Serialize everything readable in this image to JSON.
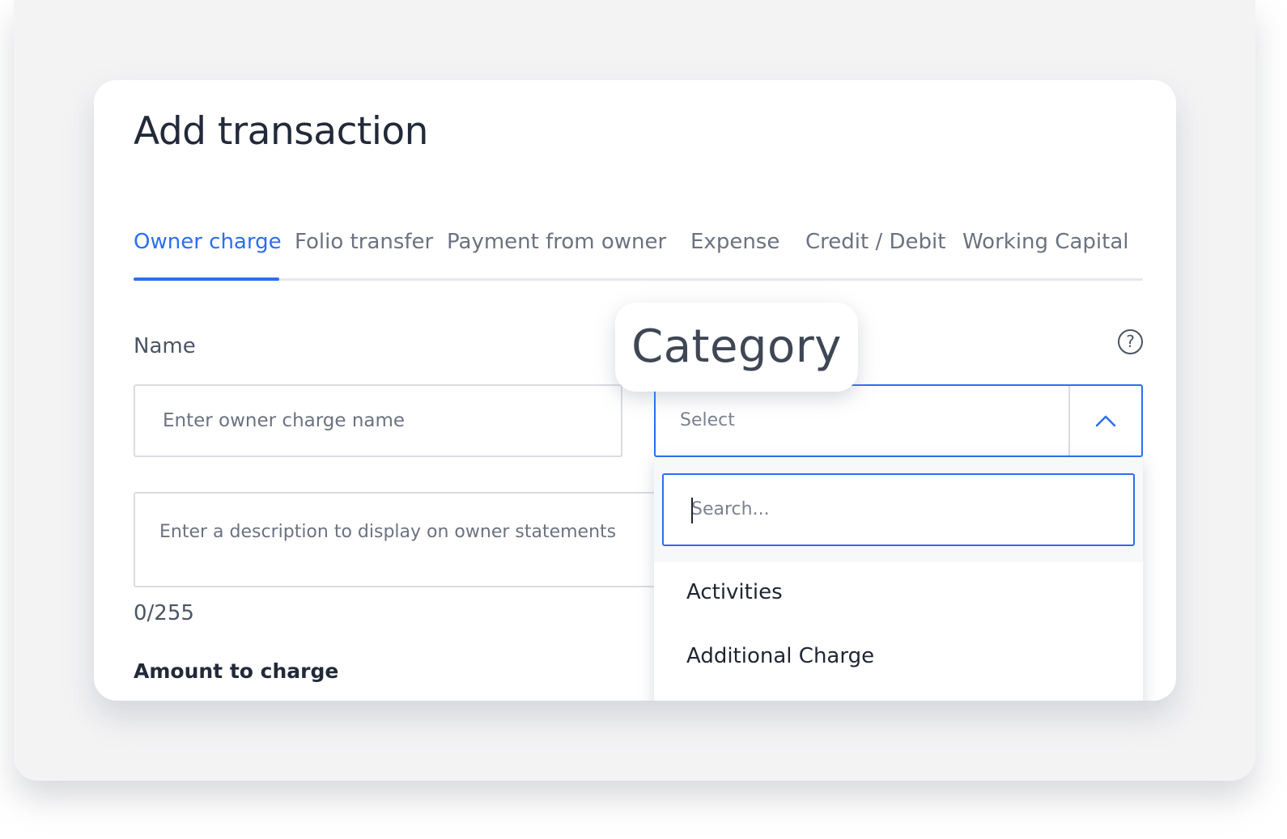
{
  "dialog": {
    "title": "Add transaction"
  },
  "tabs": [
    {
      "label": "Owner charge",
      "active": true
    },
    {
      "label": "Folio transfer",
      "active": false
    },
    {
      "label": "Payment from owner",
      "active": false
    },
    {
      "label": "Expense",
      "active": false
    },
    {
      "label": "Credit / Debit",
      "active": false
    },
    {
      "label": "Working Capital",
      "active": false
    }
  ],
  "form": {
    "name_label": "Name",
    "name_placeholder": "Enter owner charge name",
    "description_placeholder": "Enter a description to display on owner statements",
    "description_counter": "0/255",
    "amount_label": "Amount to charge",
    "help_icon": "?"
  },
  "category": {
    "label": "Category",
    "select_placeholder": "Select",
    "search_placeholder": "Search...",
    "options": [
      "Activities",
      "Additional Charge"
    ]
  },
  "colors": {
    "accent": "#2b6ef2",
    "text_dark": "#222a39",
    "text_muted": "#6b7280",
    "border": "#d9dce1"
  },
  "icons": {
    "select_toggle": "chevron-up-icon",
    "help": "help-circle-icon"
  }
}
